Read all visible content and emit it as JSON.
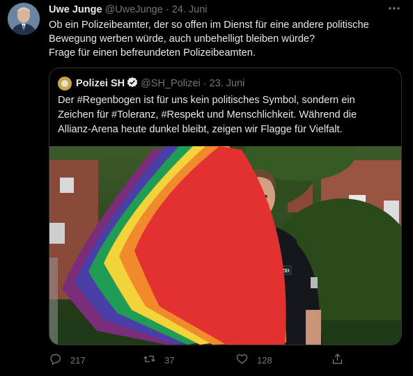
{
  "tweet": {
    "author_name": "Uwe Junge",
    "author_handle": "@UweJunge",
    "separator": "·",
    "date": "24. Juni",
    "lines": [
      "Ob ein Polizeibeamter, der so offen im Dienst für eine andere politische",
      "Bewegung werben würde, auch unbehelligt bleiben würde?",
      "Frage für einen befreundeten Polizeibeamten."
    ]
  },
  "quoted": {
    "author_name": "Polizei SH",
    "author_handle": "@SH_Polizei",
    "separator": "·",
    "date": "23. Juni",
    "lines": [
      "Der #Regenbogen ist für uns kein politisches Symbol, sondern ein",
      "Zeichen für #Toleranz, #Respekt und Menschlichkeit. Während die",
      "Allianz-Arena heute dunkel bleibt, zeigen wir Flagge für Vielfalt."
    ],
    "badge_text": "POLIZEI"
  },
  "actions": {
    "reply_count": "217",
    "retweet_count": "37",
    "like_count": "128"
  },
  "icons": {
    "more": "more-horizontal-icon",
    "reply": "reply-icon",
    "retweet": "retweet-icon",
    "like": "heart-icon",
    "share": "share-icon",
    "verified": "verified-badge-icon"
  },
  "colors": {
    "background": "#000000",
    "text": "#e7e9ea",
    "muted": "#71767b",
    "border": "#2f3336"
  }
}
